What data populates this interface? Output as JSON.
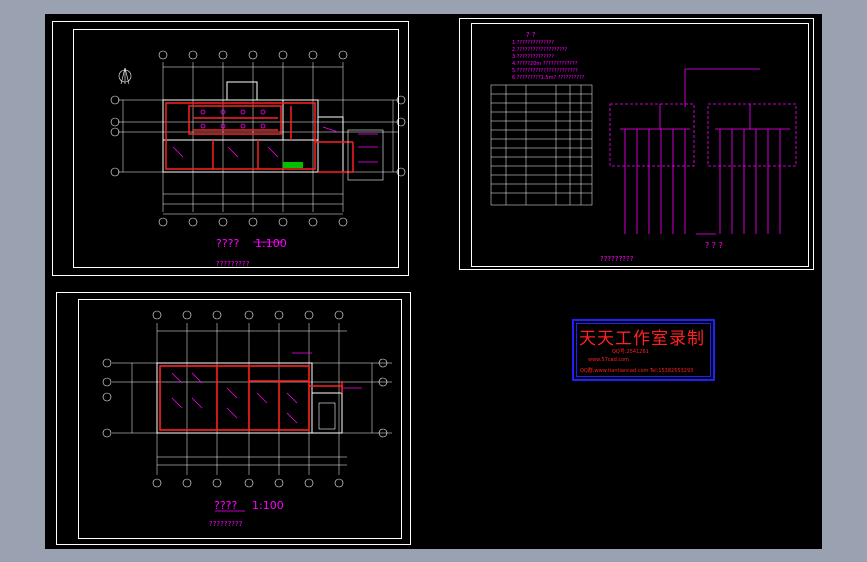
{
  "sheet1": {
    "title": "???? ",
    "scale": "1:100",
    "subtitle": "?????????",
    "axes_top": [
      "①",
      "②",
      "③",
      "④",
      "⑤",
      "⑥",
      "⑦"
    ],
    "axes_left": [
      "Ⓒ",
      "Ⓑ",
      "Ⓐ",
      "Ⓐ"
    ]
  },
  "sheet2": {
    "title": "???? ",
    "scale": "1:100",
    "subtitle": "?????????",
    "axes_top": [
      "①",
      "②",
      "③",
      "④",
      "⑤",
      "⑥",
      "⑦"
    ],
    "axes_left": [
      "Ⓒ",
      "Ⓑ",
      "Ⓑ",
      "Ⓐ"
    ]
  },
  "sheet3": {
    "legend_heading": "? ?",
    "notes": [
      "1.??????????????",
      "2.???????????????????",
      "3.??????????????",
      "4.?????20m ?????????????",
      "5.???????????????????????",
      "6.?????????1.5m? ??????????"
    ],
    "diagram_title": "? ? ?",
    "subtitle": "?????????",
    "table_rows": [
      [
        "?",
        "???",
        "???",
        "??",
        "?"
      ],
      [
        "?",
        "???",
        "???",
        "??",
        "?"
      ],
      [
        "?",
        "????",
        "???",
        "??",
        "?"
      ],
      [
        "?",
        "????",
        "???",
        "??",
        "?"
      ],
      [
        "?",
        "????",
        "???",
        "??",
        "?"
      ],
      [
        "?",
        "????",
        "???",
        "??",
        "?"
      ],
      [
        "?",
        "????",
        "???",
        "??",
        "?"
      ],
      [
        "?",
        "????",
        "???",
        "??",
        "?"
      ],
      [
        "?",
        "????",
        "???",
        "??",
        "?"
      ],
      [
        "?",
        "????",
        "???",
        "??",
        "?"
      ],
      [
        "?",
        "????",
        "???",
        "??",
        "?"
      ],
      [
        "?",
        "????",
        "???",
        "??",
        "?"
      ],
      [
        "?",
        "????",
        "???",
        "??",
        "?"
      ]
    ]
  },
  "stamp": {
    "title": "天天工作室录制",
    "line1": "QQ号:2541261",
    "line2": "www.57cad.com",
    "line3": "QQ群:www.tiantiancad.com  Tel:15382553293"
  },
  "colors": {
    "background": "#000000",
    "frame": "#ffffff",
    "wiring": "#ff2020",
    "text": "#ff00ff",
    "stamp_border": "#2020ff"
  }
}
